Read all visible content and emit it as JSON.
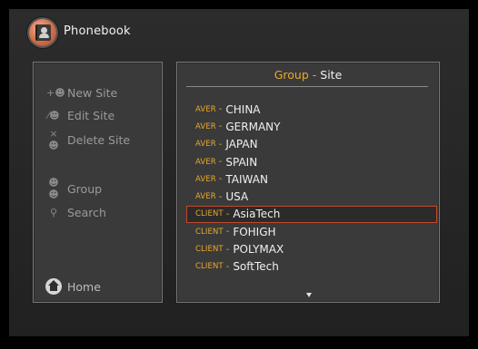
{
  "header": {
    "title": "Phonebook",
    "icon": "phonebook-icon"
  },
  "sidebar": {
    "items": [
      {
        "label": "New Site",
        "icon": "add-user-icon"
      },
      {
        "label": "Edit Site",
        "icon": "edit-user-icon"
      },
      {
        "label": "Delete Site",
        "icon": "delete-user-icon"
      },
      {
        "label": "Group",
        "icon": "group-icon"
      },
      {
        "label": "Search",
        "icon": "search-icon"
      },
      {
        "label": "Home",
        "icon": "home-icon"
      }
    ]
  },
  "list": {
    "header_group": "Group",
    "header_dash": "-",
    "header_site": "Site",
    "rows": [
      {
        "group": "AVER",
        "site": "CHINA"
      },
      {
        "group": "AVER",
        "site": "GERMANY"
      },
      {
        "group": "AVER",
        "site": "JAPAN"
      },
      {
        "group": "AVER",
        "site": "SPAIN"
      },
      {
        "group": "AVER",
        "site": "TAIWAN"
      },
      {
        "group": "AVER",
        "site": "USA"
      },
      {
        "group": "CLIENT",
        "site": "AsiaTech"
      },
      {
        "group": "CLIENT",
        "site": "FOHIGH"
      },
      {
        "group": "CLIENT",
        "site": "POLYMAX"
      },
      {
        "group": "CLIENT",
        "site": "SoftTech"
      }
    ],
    "row_separator": "-",
    "selected_index": 6
  },
  "colors": {
    "accent": "#e7a92a",
    "selection_border": "#c14a2b",
    "text": "#f0f0f0",
    "muted_text": "#9a9a9a"
  }
}
